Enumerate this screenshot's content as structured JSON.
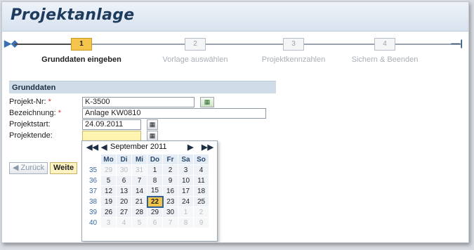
{
  "title": "Projektanlage",
  "roadmap": {
    "steps": [
      {
        "number": "1",
        "label": "Grunddaten eingeben"
      },
      {
        "number": "2",
        "label": "Vorlage auswählen"
      },
      {
        "number": "3",
        "label": "Projektkennzahlen"
      },
      {
        "number": "4",
        "label": "Sichern & Beenden"
      }
    ],
    "start_icon": "roadmap-start-icon",
    "end_icon": "roadmap-end-icon"
  },
  "section": {
    "title": "Grunddaten",
    "fields": [
      {
        "label": "Projekt-Nr:",
        "required": "*",
        "value": ""
      },
      {
        "label": "Bezeichnung:",
        "required": "*",
        "value": ""
      },
      {
        "label": "Projektstart:",
        "value": ""
      },
      {
        "label": "Projektende:",
        "value": ""
      }
    ],
    "values": {
      "projekt_nr": "K-3500",
      "bezeichnung": "Anlage KW0810",
      "projektstart": "24.09.2011",
      "projektende": ""
    }
  },
  "buttons": {
    "back": "◀ Zurück",
    "next": "Weite"
  },
  "calendar": {
    "month_label": "September 2011",
    "nav": {
      "prev_year": "◀◀",
      "prev_month": "◀",
      "next_month": "▶",
      "next_year": "▶▶"
    },
    "weekdays": [
      "Mo",
      "Di",
      "Mi",
      "Do",
      "Fr",
      "Sa",
      "So"
    ],
    "weeks": [
      {
        "week": "35",
        "days": [
          "29",
          "30",
          "31",
          "1",
          "2",
          "3",
          "4"
        ]
      },
      {
        "week": "36",
        "days": [
          "5",
          "6",
          "7",
          "8",
          "9",
          "10",
          "11"
        ]
      },
      {
        "week": "37",
        "days": [
          "12",
          "13",
          "14",
          "15",
          "16",
          "17",
          "18"
        ]
      },
      {
        "week": "38",
        "days": [
          "19",
          "20",
          "21",
          "22",
          "23",
          "24",
          "25"
        ]
      },
      {
        "week": "39",
        "days": [
          "26",
          "27",
          "28",
          "29",
          "30",
          "1",
          "2"
        ]
      },
      {
        "week": "40",
        "days": [
          "3",
          "4",
          "5",
          "6",
          "7",
          "8",
          "9"
        ]
      }
    ],
    "highlighted_day": "22"
  },
  "colors": {
    "accent": "#f4c54a",
    "title": "#1d3b5c",
    "required": "#d0342c"
  }
}
